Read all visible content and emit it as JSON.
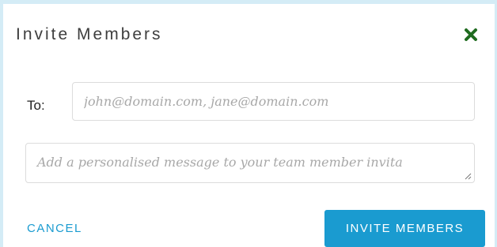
{
  "dialog": {
    "title": "Invite Members",
    "close_icon": "close-x-icon",
    "close_icon_color": "#1f6b1f"
  },
  "form": {
    "to_label": "To:",
    "to_placeholder": "john@domain.com, jane@domain.com",
    "to_value": "",
    "message_placeholder": "Add a personalised message to your team member invita",
    "message_value": ""
  },
  "actions": {
    "cancel_label": "CANCEL",
    "invite_label": "INVITE MEMBERS"
  },
  "colors": {
    "accent": "#1a9bd0",
    "backdrop": "#d4ecf6",
    "title_text": "#3e3e3e",
    "placeholder_text": "#a8a8a8"
  }
}
